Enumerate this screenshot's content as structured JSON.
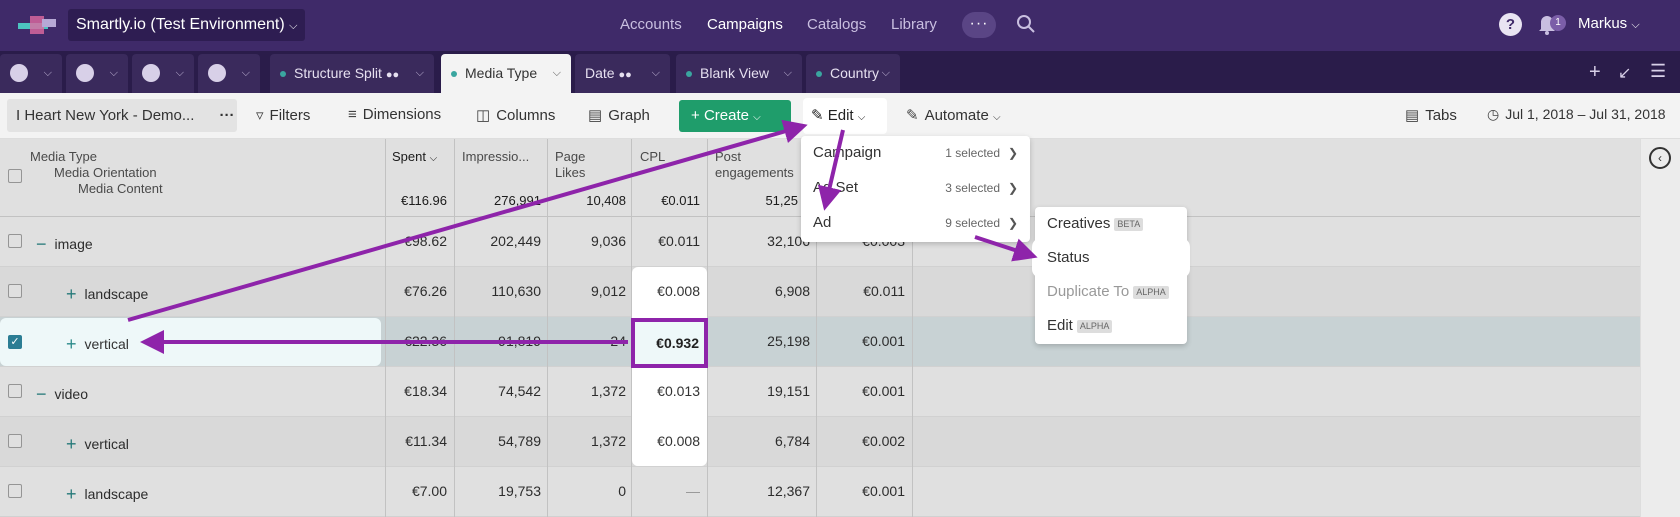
{
  "app": {
    "workspace": "Smartly.io (Test Environment)",
    "nav": [
      "Accounts",
      "Campaigns",
      "Catalogs",
      "Library"
    ],
    "nav_active": "Campaigns",
    "notifications": "1",
    "user": "Markus"
  },
  "tabs": [
    {
      "label": "Structure Split"
    },
    {
      "label": "Media Type"
    },
    {
      "label": "Date"
    },
    {
      "label": "Blank View"
    },
    {
      "label": "Country"
    }
  ],
  "toolbar": {
    "account": "I Heart New York - Demo...",
    "filters": "Filters",
    "dimensions": "Dimensions",
    "columns": "Columns",
    "graph": "Graph",
    "create": "Create",
    "edit": "Edit",
    "automate": "Automate",
    "tabs": "Tabs",
    "date_range": "Jul 1, 2018 – Jul 31, 2018"
  },
  "table": {
    "dim_header": [
      "Media Type",
      "Media Orientation",
      "Media Content"
    ],
    "columns": [
      "Spent",
      "Impressio...",
      "Page Likes",
      "CPL",
      "Post engagements"
    ],
    "totals": [
      "€116.96",
      "276,991",
      "10,408",
      "€0.011",
      "51,25"
    ],
    "rows": [
      {
        "name": "image",
        "spent": "€98.62",
        "impr": "202,449",
        "likes": "9,036",
        "cpl": "€0.011",
        "post": "32,106",
        "extra": "€0.003"
      },
      {
        "name": "landscape",
        "spent": "€76.26",
        "impr": "110,630",
        "likes": "9,012",
        "cpl": "€0.008",
        "post": "6,908",
        "extra": "€0.011"
      },
      {
        "name": "vertical",
        "spent": "€22.36",
        "impr": "91,819",
        "likes": "24",
        "cpl": "€0.932",
        "post": "25,198",
        "extra": "€0.001"
      },
      {
        "name": "video",
        "spent": "€18.34",
        "impr": "74,542",
        "likes": "1,372",
        "cpl": "€0.013",
        "post": "19,151",
        "extra": "€0.001"
      },
      {
        "name": "vertical",
        "spent": "€11.34",
        "impr": "54,789",
        "likes": "1,372",
        "cpl": "€0.008",
        "post": "6,784",
        "extra": "€0.002"
      },
      {
        "name": "landscape",
        "spent": "€7.00",
        "impr": "19,753",
        "likes": "0",
        "cpl": "—",
        "post": "12,367",
        "extra": "€0.001"
      }
    ]
  },
  "edit_menu": [
    {
      "label": "Campaign",
      "count": "1 selected"
    },
    {
      "label": "Ad Set",
      "count": "3 selected"
    },
    {
      "label": "Ad",
      "count": "9 selected"
    }
  ],
  "ad_submenu": [
    {
      "label": "Creatives",
      "badge": "BETA"
    },
    {
      "label": "Status",
      "badge": ""
    },
    {
      "label": "Duplicate To",
      "badge": "ALPHA"
    },
    {
      "label": "Edit",
      "badge": "ALPHA"
    }
  ],
  "colors": {
    "nav_bg": "#3f2a69",
    "accent": "#8e24aa",
    "create_green": "#1f9d6b"
  }
}
